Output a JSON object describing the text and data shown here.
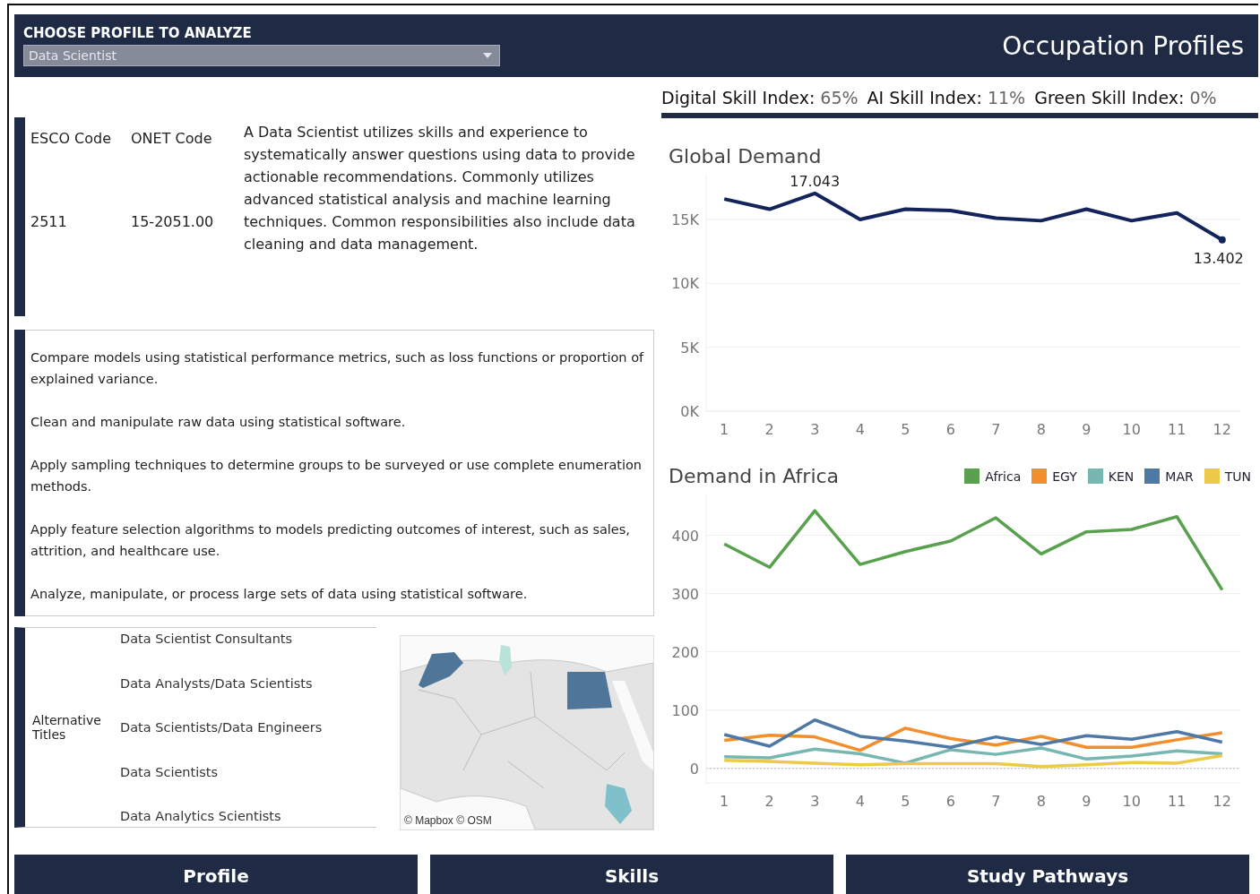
{
  "header": {
    "filter_label": "CHOOSE PROFILE TO ANALYZE",
    "dropdown": {
      "value": "Data Scientist"
    },
    "title": "Occupation Profiles"
  },
  "codes": {
    "columns": [
      "ESCO Code",
      "ONET Code"
    ],
    "values": [
      "2511",
      "15-2051.00"
    ],
    "description": "A Data Scientist utilizes skills and experience to systematically answer questions using data to provide actionable recommendations. Commonly utilizes advanced statistical analysis and machine learning techniques. Common responsibilities also include data cleaning and data management."
  },
  "tasks": [
    "Compare models using statistical performance metrics, such as loss functions or proportion of explained variance.",
    "Clean and manipulate raw data using statistical software.",
    "Apply sampling techniques to determine groups to be surveyed or use complete enumeration methods.",
    "Apply feature selection algorithms to models predicting outcomes of interest, such as sales, attrition, and healthcare use.",
    "Analyze, manipulate, or process large sets of data using statistical software."
  ],
  "alternative_titles": {
    "label": "Alternative Titles",
    "items": [
      "Data Scientist Consultants",
      "Data Analysts/Data Scientists",
      "Data Scientists/Data Engineers",
      "Data Scientists",
      "Data Analytics Scientists"
    ]
  },
  "map": {
    "kind": "picture",
    "attribution": "© Mapbox  © OSM"
  },
  "indices": [
    {
      "label": "Digital Skill Index:",
      "value": "65%"
    },
    {
      "label": "AI Skill Index:",
      "value": "11%"
    },
    {
      "label": "Green Skill Index:",
      "value": "0%"
    }
  ],
  "global_demand": {
    "chart_data": {
      "type": "line",
      "title": "Global Demand",
      "x": [
        1,
        2,
        3,
        4,
        5,
        6,
        7,
        8,
        9,
        10,
        11,
        12
      ],
      "series": [
        {
          "color": "#13235b",
          "values": [
            16600,
            15800,
            17043,
            15000,
            15800,
            15700,
            15100,
            14900,
            15800,
            14900,
            15500,
            13402
          ]
        }
      ],
      "ylim": [
        0,
        18500
      ],
      "xlim": [
        0.6,
        12.4
      ],
      "grid": true,
      "xticks": [
        1,
        2,
        3,
        4,
        5,
        6,
        7,
        8,
        9,
        10,
        11,
        12
      ],
      "yticks": [
        {
          "value": 0,
          "label": "0K"
        },
        {
          "value": 5000,
          "label": "5K"
        },
        {
          "value": 10000,
          "label": "10K"
        },
        {
          "value": 15000,
          "label": "15K"
        }
      ],
      "annotations": [
        {
          "x": 3,
          "y": 17043,
          "text": "17.043"
        },
        {
          "x": 12,
          "y": 13402,
          "text": "13.402"
        }
      ]
    }
  },
  "africa_demand": {
    "chart_data": {
      "type": "line",
      "title": "Demand in Africa",
      "x": [
        1,
        2,
        3,
        4,
        5,
        6,
        7,
        8,
        9,
        10,
        11,
        12
      ],
      "series": [
        {
          "name": "Africa",
          "color": "#59a14f",
          "values": [
            385,
            345,
            442,
            350,
            372,
            390,
            430,
            368,
            406,
            410,
            432,
            306
          ]
        },
        {
          "name": "EGY",
          "color": "#f28e2b",
          "values": [
            48,
            57,
            54,
            31,
            69,
            51,
            40,
            55,
            36,
            36,
            49,
            61
          ]
        },
        {
          "name": "KEN",
          "color": "#76b7b2",
          "values": [
            20,
            18,
            33,
            25,
            9,
            32,
            24,
            35,
            16,
            21,
            30,
            25
          ]
        },
        {
          "name": "MAR",
          "color": "#4e79a7",
          "values": [
            58,
            38,
            83,
            55,
            47,
            36,
            54,
            41,
            56,
            50,
            63,
            45
          ]
        },
        {
          "name": "TUN",
          "color": "#edc948",
          "values": [
            14,
            12,
            9,
            6,
            8,
            8,
            8,
            3,
            6,
            10,
            9,
            22
          ]
        }
      ],
      "ylim": [
        -25,
        470
      ],
      "xlim": [
        0.6,
        12.4
      ],
      "grid": true,
      "ref_lines": [
        {
          "axis": "y",
          "value": 0
        }
      ],
      "xticks": [
        1,
        2,
        3,
        4,
        5,
        6,
        7,
        8,
        9,
        10,
        11,
        12
      ],
      "yticks": [
        0,
        100,
        200,
        300,
        400
      ]
    }
  },
  "nav": [
    "Profile",
    "Skills",
    "Study Pathways"
  ]
}
